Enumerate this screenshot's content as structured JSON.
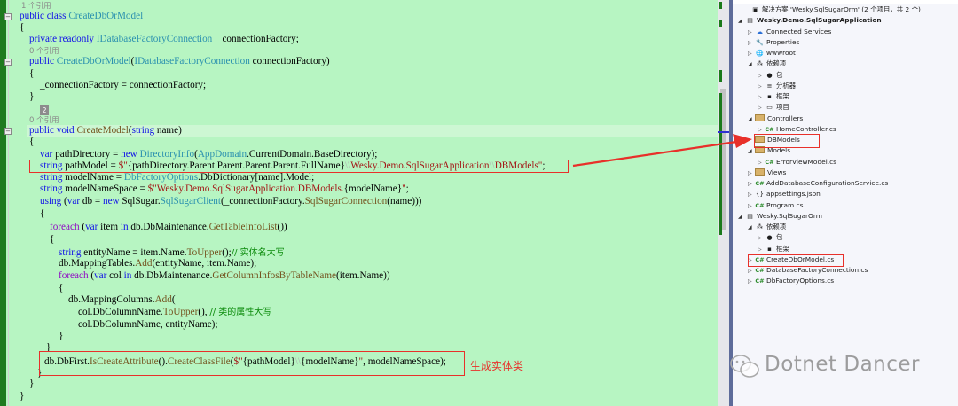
{
  "editor": {
    "codelens_refs": [
      "1 个引用",
      "0 个引用",
      "0 个引用"
    ],
    "badge": "2",
    "lines": [
      {
        "indent": 0,
        "tokens": [
          [
            "public class ",
            "kw"
          ],
          [
            "CreateDbOrModel",
            "ty"
          ]
        ]
      },
      {
        "indent": 0,
        "tokens": [
          [
            "{",
            "pl"
          ]
        ]
      },
      {
        "indent": 1,
        "tokens": [
          [
            "private readonly ",
            "kw"
          ],
          [
            "IDatabaseFactoryConnection",
            "ty"
          ],
          [
            "  _connectionFactory;",
            "pl"
          ]
        ]
      },
      {
        "indent": 1,
        "tokens": [
          [
            "public ",
            "kw"
          ],
          [
            "CreateDbOrModel",
            "ty"
          ],
          [
            "(",
            "pl"
          ],
          [
            "IDatabaseFactoryConnection",
            "ty"
          ],
          [
            " connectionFactory)",
            "pl"
          ]
        ]
      },
      {
        "indent": 1,
        "tokens": [
          [
            "{",
            "pl"
          ]
        ]
      },
      {
        "indent": 2,
        "tokens": [
          [
            "_connectionFactory = connectionFactory;",
            "pl"
          ]
        ]
      },
      {
        "indent": 1,
        "tokens": [
          [
            "}",
            "pl"
          ]
        ]
      },
      {
        "indent": 1,
        "tokens": [
          [
            "public void ",
            "kw"
          ],
          [
            "CreateModel",
            "me"
          ],
          [
            "(",
            "pl"
          ],
          [
            "string",
            "kw"
          ],
          [
            " name)",
            "pl"
          ]
        ]
      },
      {
        "indent": 1,
        "tokens": [
          [
            "{",
            "pl"
          ]
        ]
      },
      {
        "indent": 2,
        "tokens": [
          [
            "var",
            "kw"
          ],
          [
            " pathDirectory = ",
            "pl"
          ],
          [
            "new ",
            "kw"
          ],
          [
            "DirectoryInfo",
            "ty"
          ],
          [
            "(",
            "pl"
          ],
          [
            "AppDomain",
            "ty"
          ],
          [
            ".CurrentDomain.BaseDirectory);",
            "pl"
          ]
        ]
      },
      {
        "indent": 2,
        "tokens": [
          [
            "string",
            "kw"
          ],
          [
            " pathModel = ",
            "pl"
          ],
          [
            "$\"",
            "st"
          ],
          [
            "{pathDirectory.Parent.Parent.Parent.Parent.FullName}",
            "pl"
          ],
          [
            "\\\\",
            "sk"
          ],
          [
            "Wesky.Demo.SqlSugarApplication",
            "st"
          ],
          [
            "\\\\",
            "sk"
          ],
          [
            "DBModels\"",
            "st"
          ],
          [
            ";",
            "pl"
          ]
        ]
      },
      {
        "indent": 2,
        "tokens": [
          [
            "string",
            "kw"
          ],
          [
            " modelName = ",
            "pl"
          ],
          [
            "DbFactoryOptions",
            "ty"
          ],
          [
            ".DbDictionary[name].Model;",
            "pl"
          ]
        ]
      },
      {
        "indent": 2,
        "tokens": [
          [
            "string",
            "kw"
          ],
          [
            " modelNameSpace = ",
            "pl"
          ],
          [
            "$\"Wesky.Demo.SqlSugarApplication.DBModels.",
            "st"
          ],
          [
            "{modelName}",
            "pl"
          ],
          [
            "\"",
            "st"
          ],
          [
            ";",
            "pl"
          ]
        ]
      },
      {
        "indent": 2,
        "tokens": [
          [
            "using",
            "kw"
          ],
          [
            " (",
            "pl"
          ],
          [
            "var",
            "kw"
          ],
          [
            " db = ",
            "pl"
          ],
          [
            "new ",
            "kw"
          ],
          [
            "SqlSugar.",
            "pl"
          ],
          [
            "SqlSugarClient",
            "ty"
          ],
          [
            "(_connectionFactory.",
            "pl"
          ],
          [
            "SqlSugarConnection",
            "me"
          ],
          [
            "(name)))",
            "pl"
          ]
        ]
      },
      {
        "indent": 2,
        "tokens": [
          [
            "{",
            "pl"
          ]
        ]
      },
      {
        "indent": 3,
        "tokens": [
          [
            "foreach",
            "ct"
          ],
          [
            " (",
            "pl"
          ],
          [
            "var",
            "kw"
          ],
          [
            " item ",
            "pl"
          ],
          [
            "in",
            "kw"
          ],
          [
            " db.DbMaintenance.",
            "pl"
          ],
          [
            "GetTableInfoList",
            "me"
          ],
          [
            "())",
            "pl"
          ]
        ]
      },
      {
        "indent": 3,
        "tokens": [
          [
            "{",
            "pl"
          ]
        ]
      },
      {
        "indent": 4,
        "tokens": [
          [
            "string",
            "kw"
          ],
          [
            " entityName = item.Name.",
            "pl"
          ],
          [
            "ToUpper",
            "me"
          ],
          [
            "();",
            "pl"
          ],
          [
            "// 实体名大写",
            "cm"
          ]
        ]
      },
      {
        "indent": 4,
        "tokens": [
          [
            "db.MappingTables.",
            "pl"
          ],
          [
            "Add",
            "me"
          ],
          [
            "(entityName, item.Name);",
            "pl"
          ]
        ]
      },
      {
        "indent": 4,
        "tokens": [
          [
            "foreach",
            "ct"
          ],
          [
            " (",
            "pl"
          ],
          [
            "var",
            "kw"
          ],
          [
            " col ",
            "pl"
          ],
          [
            "in",
            "kw"
          ],
          [
            " db.DbMaintenance.",
            "pl"
          ],
          [
            "GetColumnInfosByTableName",
            "me"
          ],
          [
            "(item.Name))",
            "pl"
          ]
        ]
      },
      {
        "indent": 4,
        "tokens": [
          [
            "{",
            "pl"
          ]
        ]
      },
      {
        "indent": 5,
        "tokens": [
          [
            "db.MappingColumns.",
            "pl"
          ],
          [
            "Add",
            "me"
          ],
          [
            "(",
            "pl"
          ]
        ]
      },
      {
        "indent": 6,
        "tokens": [
          [
            "col.DbColumnName.",
            "pl"
          ],
          [
            "ToUpper",
            "me"
          ],
          [
            "(), ",
            "pl"
          ],
          [
            "// 类的属性大写",
            "cm"
          ]
        ]
      },
      {
        "indent": 6,
        "tokens": [
          [
            "col.DbColumnName, entityName);",
            "pl"
          ]
        ]
      },
      {
        "indent": 4,
        "tokens": [
          [
            "}",
            "pl"
          ]
        ]
      },
      {
        "indent": 3,
        "tokens": [
          [
            "}",
            "pl"
          ]
        ]
      },
      {
        "indent": 2,
        "tokens": [
          [
            "db.DbFirst.",
            "pl"
          ],
          [
            "IsCreateAttribute",
            "me"
          ],
          [
            "().",
            "pl"
          ],
          [
            "CreateClassFile",
            "me"
          ],
          [
            "(",
            "pl"
          ],
          [
            "$\"",
            "st"
          ],
          [
            "{pathModel}",
            "pl"
          ],
          [
            "\\\\",
            "sk"
          ],
          [
            "{modelName}",
            "pl"
          ],
          [
            "\"",
            "st"
          ],
          [
            ", modelNameSpace);",
            "pl"
          ]
        ]
      },
      {
        "indent": 2,
        "tokens": [
          [
            "}",
            "pl"
          ]
        ]
      },
      {
        "indent": 1,
        "tokens": [
          [
            "}",
            "pl"
          ]
        ]
      },
      {
        "indent": 0,
        "tokens": [
          [
            "}",
            "pl"
          ]
        ]
      }
    ],
    "annotation": "生成实体类",
    "highlight_color": "#e8302a"
  },
  "solution_explorer": {
    "items": [
      {
        "label": "解决方案 'Wesky.SqlSugarOrm' (2 个项目，共 2 个)",
        "icon": "solution-icon",
        "level": 0,
        "exp": ""
      },
      {
        "label": "Wesky.Demo.SqlSugarApplication",
        "icon": "project-icon",
        "level": 0,
        "exp": "open",
        "bold": true
      },
      {
        "label": "Connected Services",
        "icon": "connected-services-icon",
        "level": 1,
        "exp": "closed"
      },
      {
        "label": "Properties",
        "icon": "properties-icon",
        "level": 1,
        "exp": "closed"
      },
      {
        "label": "wwwroot",
        "icon": "globe-icon",
        "level": 1,
        "exp": "closed"
      },
      {
        "label": "依赖项",
        "icon": "dependencies-icon",
        "level": 1,
        "exp": "open"
      },
      {
        "label": "包",
        "icon": "package-icon",
        "level": 2,
        "exp": "closed"
      },
      {
        "label": "分析器",
        "icon": "analyzer-icon",
        "level": 2,
        "exp": "closed"
      },
      {
        "label": "框架",
        "icon": "framework-icon",
        "level": 2,
        "exp": "closed"
      },
      {
        "label": "项目",
        "icon": "project-ref-icon",
        "level": 2,
        "exp": "closed"
      },
      {
        "label": "Controllers",
        "icon": "folder-icon",
        "level": 1,
        "exp": "open"
      },
      {
        "label": "HomeController.cs",
        "icon": "csharp-file-icon",
        "level": 2,
        "exp": "closed"
      },
      {
        "label": "DBModels",
        "icon": "folder-icon",
        "level": 1,
        "exp": "",
        "boxed": true
      },
      {
        "label": "Models",
        "icon": "folder-icon",
        "level": 1,
        "exp": "open"
      },
      {
        "label": "ErrorViewModel.cs",
        "icon": "csharp-file-icon",
        "level": 2,
        "exp": "closed"
      },
      {
        "label": "Views",
        "icon": "folder-icon",
        "level": 1,
        "exp": "closed"
      },
      {
        "label": "AddDatabaseConfigurationService.cs",
        "icon": "csharp-file-icon",
        "level": 1,
        "exp": "closed"
      },
      {
        "label": "appsettings.json",
        "icon": "json-file-icon",
        "level": 1,
        "exp": "closed"
      },
      {
        "label": "Program.cs",
        "icon": "csharp-file-icon",
        "level": 1,
        "exp": "closed"
      },
      {
        "label": "Wesky.SqlSugarOrm",
        "icon": "project-icon",
        "level": 0,
        "exp": "open"
      },
      {
        "label": "依赖项",
        "icon": "dependencies-icon",
        "level": 1,
        "exp": "open"
      },
      {
        "label": "包",
        "icon": "package-icon",
        "level": 2,
        "exp": "closed"
      },
      {
        "label": "框架",
        "icon": "framework-icon",
        "level": 2,
        "exp": "closed"
      },
      {
        "label": "CreateDbOrModel.cs",
        "icon": "csharp-file-icon",
        "level": 1,
        "exp": "closed",
        "boxed": true
      },
      {
        "label": "DatabaseFactoryConnection.cs",
        "icon": "csharp-file-icon",
        "level": 1,
        "exp": "closed"
      },
      {
        "label": "DbFactoryOptions.cs",
        "icon": "csharp-file-icon",
        "level": 1,
        "exp": "closed"
      }
    ]
  },
  "watermark": {
    "text": "Dotnet Dancer",
    "icon": "wechat-icon"
  }
}
